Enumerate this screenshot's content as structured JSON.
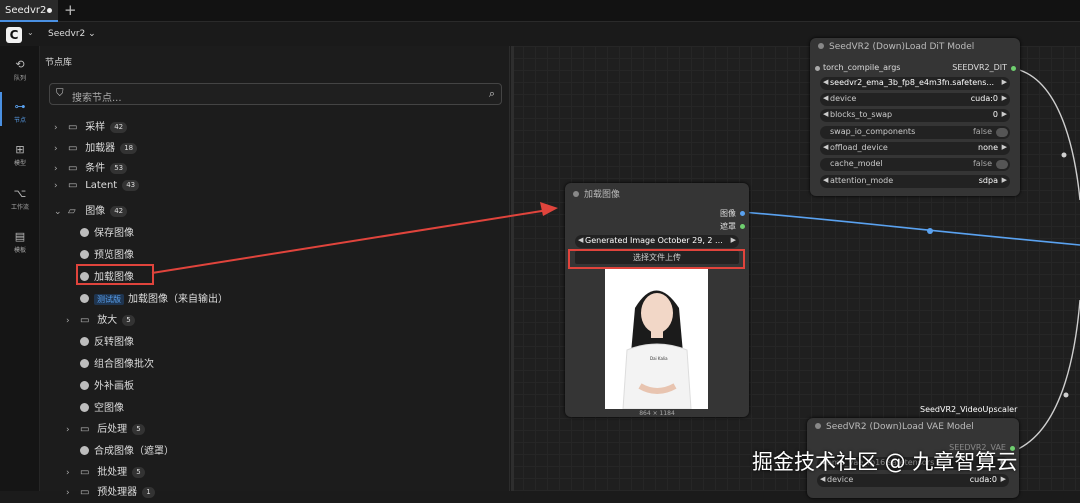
{
  "tabs": [
    {
      "label": "Seedvr2",
      "modified": true
    }
  ],
  "menubar": {
    "workflow_menu": "Seedvr2 ⌄"
  },
  "rail": [
    {
      "icon": "history-icon",
      "label": "队列"
    },
    {
      "icon": "node-icon",
      "label": "节点"
    },
    {
      "icon": "model-icon",
      "label": "模型"
    },
    {
      "icon": "workflow-icon",
      "label": "工作流"
    },
    {
      "icon": "template-icon",
      "label": "模板"
    }
  ],
  "library": {
    "title": "节点库",
    "search_placeholder": "搜索节点...",
    "items": [
      {
        "type": "folder",
        "label": "采样",
        "count": "42"
      },
      {
        "type": "folder",
        "label": "加载器",
        "count": "18"
      },
      {
        "type": "folder",
        "label": "条件",
        "count": "53"
      },
      {
        "type": "folder",
        "label": "Latent",
        "count": "43"
      },
      {
        "type": "folder-open",
        "label": "图像",
        "count": "42"
      },
      {
        "type": "leaf",
        "label": "保存图像"
      },
      {
        "type": "leaf",
        "label": "预览图像"
      },
      {
        "type": "leaf",
        "label": "加载图像"
      },
      {
        "type": "leaf-beta",
        "beta": "测试版",
        "label": "加载图像（来自输出）"
      },
      {
        "type": "subfolder",
        "label": "放大",
        "count": "5"
      },
      {
        "type": "leaf",
        "label": "反转图像"
      },
      {
        "type": "leaf",
        "label": "组合图像批次"
      },
      {
        "type": "leaf",
        "label": "外补画板"
      },
      {
        "type": "leaf",
        "label": "空图像"
      },
      {
        "type": "subfolder",
        "label": "后处理",
        "count": "5"
      },
      {
        "type": "leaf",
        "label": "合成图像（遮罩）"
      },
      {
        "type": "subfolder",
        "label": "批处理",
        "count": "5"
      },
      {
        "type": "subfolder",
        "label": "预处理器",
        "count": "1"
      }
    ]
  },
  "load_image_node": {
    "title": "加载图像",
    "output_image": "图像",
    "output_mask": "遮罩",
    "image_select": "Generated Image October 29, 2 ...",
    "upload_button": "选择文件上传",
    "preview_tshirt_text": "Dai Kalia",
    "image_size": "864 × 1184"
  },
  "dit_node": {
    "title": "SeedVR2 (Down)Load DiT Model",
    "input": "torch_compile_args",
    "output": "SEEDVR2_DIT",
    "model": "seedvr2_ema_3b_fp8_e4m3fn.safetens...",
    "widgets": [
      {
        "label": "device",
        "value": "cuda:0",
        "kind": "combo"
      },
      {
        "label": "blocks_to_swap",
        "value": "0",
        "kind": "combo"
      },
      {
        "label": "swap_io_components",
        "value": "false",
        "kind": "toggle"
      },
      {
        "label": "offload_device",
        "value": "none",
        "kind": "combo"
      },
      {
        "label": "cache_model",
        "value": "false",
        "kind": "toggle"
      },
      {
        "label": "attention_mode",
        "value": "sdpa",
        "kind": "combo"
      }
    ]
  },
  "upscaler_title": "SeedVR2_VideoUpscaler",
  "vae_node": {
    "title": "SeedVR2 (Down)Load VAE Model",
    "output": "SEEDVR2_VAE",
    "model_partial": "ema_vae_fp16.safetensors",
    "device_label": "device",
    "device_value": "cuda:0"
  },
  "watermark": "掘金技术社区 @ 九章智算云",
  "colors": {
    "accent": "#4a90e2",
    "highlight": "#e0443c",
    "link_blue": "#5aa2f0",
    "link_white": "#cfcfcf"
  }
}
